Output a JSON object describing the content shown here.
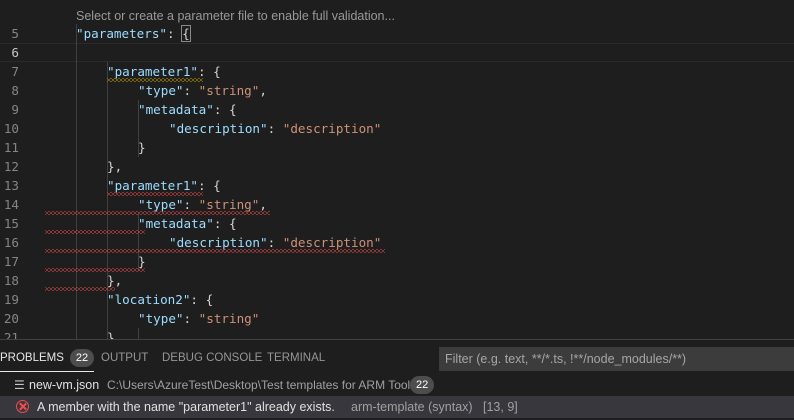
{
  "editor": {
    "codelens": "Select or create a parameter file to enable full validation...",
    "lines": [
      {
        "n": "5",
        "tokens": [
          {
            "t": "k",
            "v": "\"parameters\""
          },
          {
            "t": "p",
            "v": ": "
          },
          {
            "t": "p",
            "v": "{"
          }
        ]
      },
      {
        "n": "6",
        "tokens": []
      },
      {
        "n": "7",
        "tokens": [
          {
            "t": "k",
            "v": "\"parameter1\""
          },
          {
            "t": "p",
            "v": ": {"
          }
        ]
      },
      {
        "n": "8",
        "tokens": [
          {
            "t": "k",
            "v": "\"type\""
          },
          {
            "t": "p",
            "v": ": "
          },
          {
            "t": "s",
            "v": "\"string\""
          },
          {
            "t": "p",
            "v": ","
          }
        ]
      },
      {
        "n": "9",
        "tokens": [
          {
            "t": "k",
            "v": "\"metadata\""
          },
          {
            "t": "p",
            "v": ": {"
          }
        ]
      },
      {
        "n": "10",
        "tokens": [
          {
            "t": "k",
            "v": "\"description\""
          },
          {
            "t": "p",
            "v": ": "
          },
          {
            "t": "s",
            "v": "\"description\""
          }
        ]
      },
      {
        "n": "11",
        "tokens": [
          {
            "t": "p",
            "v": "}"
          }
        ]
      },
      {
        "n": "12",
        "tokens": [
          {
            "t": "p",
            "v": "},"
          }
        ]
      },
      {
        "n": "13",
        "tokens": [
          {
            "t": "k",
            "v": "\"parameter1\""
          },
          {
            "t": "p",
            "v": ": {"
          }
        ]
      },
      {
        "n": "14",
        "tokens": [
          {
            "t": "k",
            "v": "\"type\""
          },
          {
            "t": "p",
            "v": ": "
          },
          {
            "t": "s",
            "v": "\"string\""
          },
          {
            "t": "p",
            "v": ","
          }
        ]
      },
      {
        "n": "15",
        "tokens": [
          {
            "t": "k",
            "v": "\"metadata\""
          },
          {
            "t": "p",
            "v": ": {"
          }
        ]
      },
      {
        "n": "16",
        "tokens": [
          {
            "t": "k",
            "v": "\"description\""
          },
          {
            "t": "p",
            "v": ": "
          },
          {
            "t": "s",
            "v": "\"description\""
          }
        ]
      },
      {
        "n": "17",
        "tokens": [
          {
            "t": "p",
            "v": "}"
          }
        ]
      },
      {
        "n": "18",
        "tokens": [
          {
            "t": "p",
            "v": "},"
          }
        ]
      },
      {
        "n": "19",
        "tokens": [
          {
            "t": "k",
            "v": "\"location2\""
          },
          {
            "t": "p",
            "v": ": {"
          }
        ]
      },
      {
        "n": "20",
        "tokens": [
          {
            "t": "k",
            "v": "\"type\""
          },
          {
            "t": "p",
            "v": ": "
          },
          {
            "t": "s",
            "v": "\"string\""
          }
        ]
      },
      {
        "n": "21",
        "tokens": [
          {
            "t": "p",
            "v": "},"
          }
        ]
      }
    ]
  },
  "panel": {
    "tabs": {
      "problems": "PROBLEMS",
      "problems_count": "22",
      "output": "OUTPUT",
      "debug_console": "DEBUG CONSOLE",
      "terminal": "TERMINAL"
    },
    "filter_placeholder": "Filter (e.g. text, **/*.ts, !**/node_modules/**)",
    "file": {
      "name": "new-vm.json",
      "path": "C:\\Users\\AzureTest\\Desktop\\Test templates for ARM Tools",
      "count": "22"
    },
    "problem": {
      "message": "A member with the name \"parameter1\" already exists.",
      "source": "arm-template (syntax)",
      "position": "[13, 9]"
    }
  },
  "colors": {
    "background": "#1e1e1e",
    "key": "#9cdcfe",
    "string": "#ce9178",
    "error": "#f14c4c",
    "warning": "#cca700"
  }
}
